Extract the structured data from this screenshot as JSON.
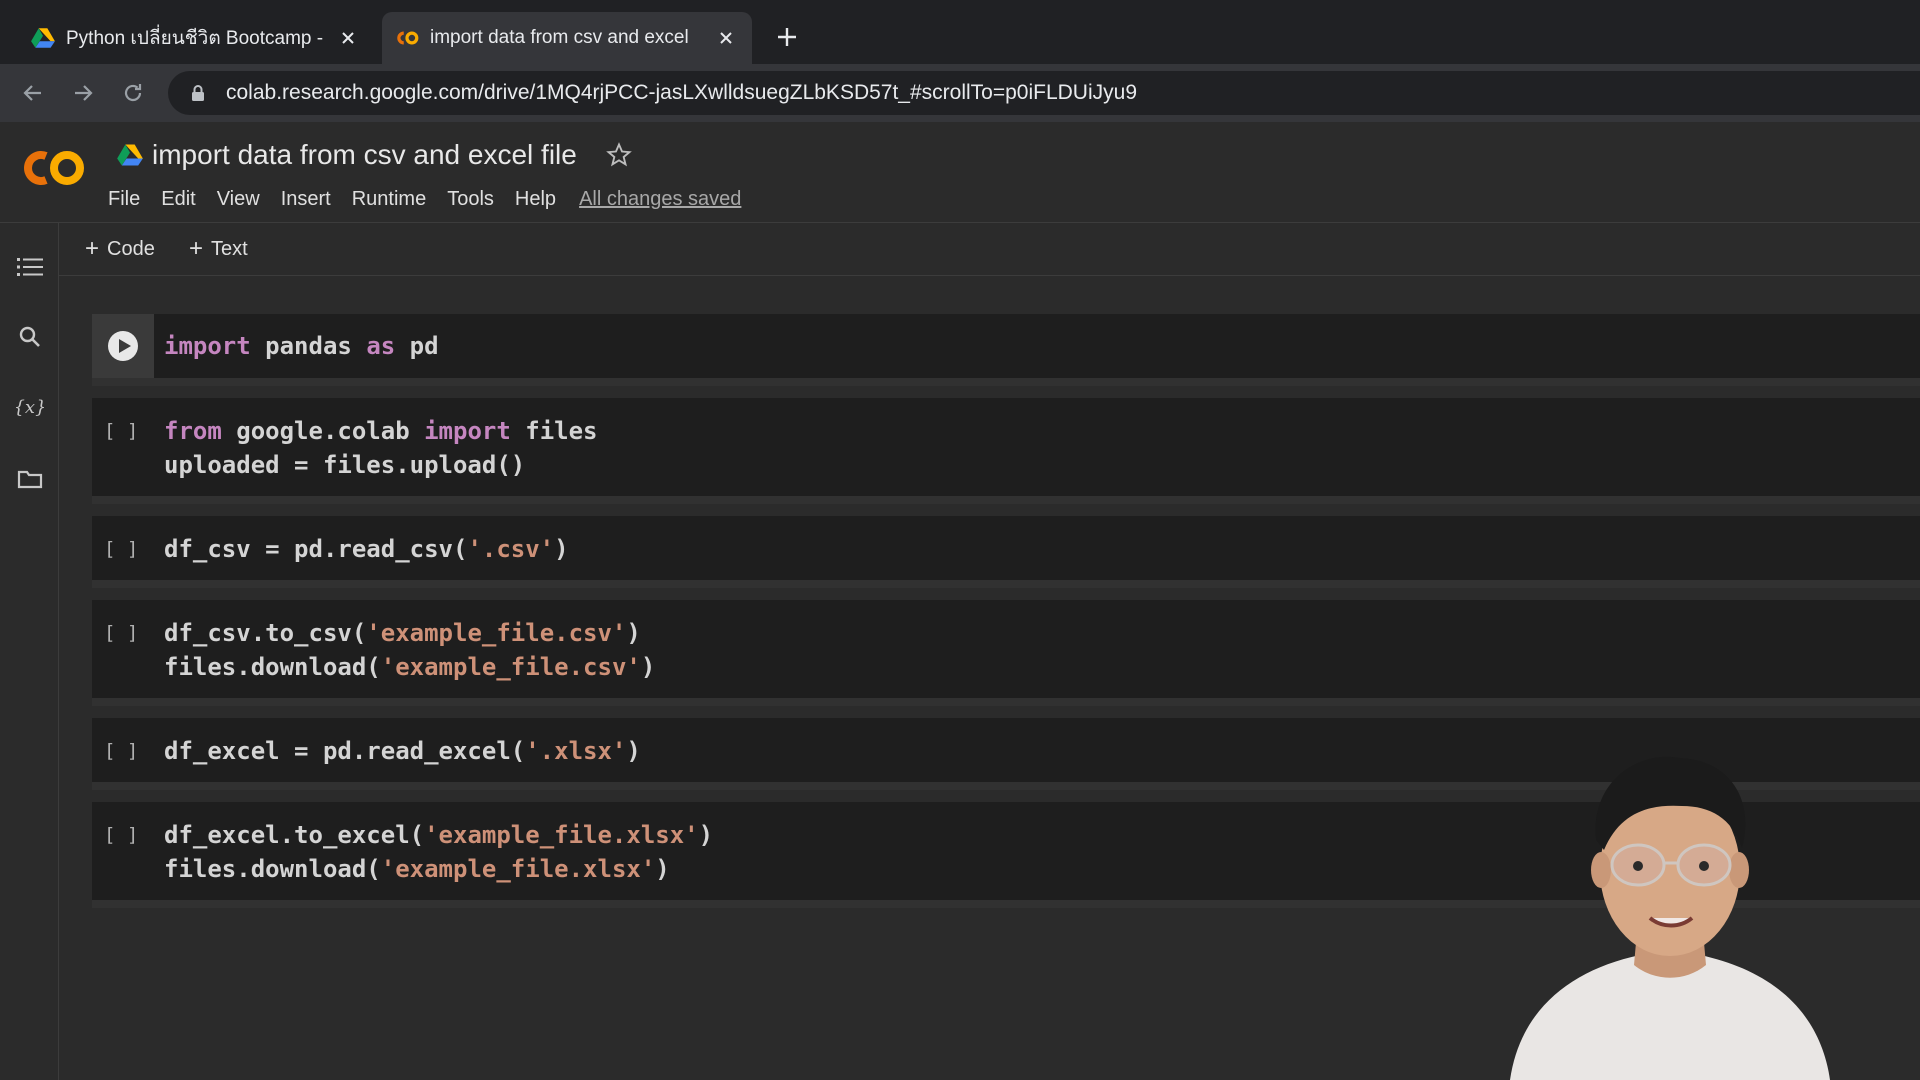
{
  "browser": {
    "tabs": [
      {
        "title": "Python เปลี่ยนชีวิต Bootcamp - (",
        "active": false
      },
      {
        "title": "import data from csv and excel",
        "active": true
      }
    ],
    "url": "colab.research.google.com/drive/1MQ4rjPCC-jasLXwlldsuegZLbKSD57t_#scrollTo=p0iFLDUiJyu9"
  },
  "colab": {
    "logo_text": "CO",
    "notebook_title": "import data from csv and excel file",
    "menu": [
      "File",
      "Edit",
      "View",
      "Insert",
      "Runtime",
      "Tools",
      "Help"
    ],
    "save_status": "All changes saved",
    "add_code_label": "Code",
    "add_text_label": "Text"
  },
  "rail_icons": [
    "table-of-contents-icon",
    "search-icon",
    "variables-icon",
    "files-folder-icon"
  ],
  "cells": [
    {
      "bracket": "",
      "lines": [
        [
          [
            "kw",
            "import"
          ],
          [
            "",
            "pandas "
          ],
          [
            "kw",
            "as"
          ],
          [
            "",
            "pd"
          ]
        ]
      ]
    },
    {
      "bracket": "[ ]",
      "lines": [
        [
          [
            "kw",
            "from"
          ],
          [
            "",
            "google.colab "
          ],
          [
            "kw",
            "import"
          ],
          [
            "",
            "files"
          ]
        ],
        [
          [
            "",
            "uploaded = files.upload()"
          ]
        ]
      ]
    },
    {
      "bracket": "[ ]",
      "lines": [
        [
          [
            "",
            "df_csv = pd.read_csv("
          ],
          [
            "str",
            "'.csv'"
          ],
          [
            "",
            ")"
          ]
        ]
      ]
    },
    {
      "bracket": "[ ]",
      "lines": [
        [
          [
            "",
            "df_csv.to_csv("
          ],
          [
            "str",
            "'example_file.csv'"
          ],
          [
            "",
            ")"
          ]
        ],
        [
          [
            "",
            "files.download("
          ],
          [
            "str",
            "'example_file.csv'"
          ],
          [
            "",
            ")"
          ]
        ]
      ]
    },
    {
      "bracket": "[ ]",
      "lines": [
        [
          [
            "",
            "df_excel = pd.read_excel("
          ],
          [
            "str",
            "'.xlsx'"
          ],
          [
            "",
            ")"
          ]
        ]
      ]
    },
    {
      "bracket": "[ ]",
      "lines": [
        [
          [
            "",
            "df_excel.to_excel("
          ],
          [
            "str",
            "'example_file.xlsx'"
          ],
          [
            "",
            ")"
          ]
        ],
        [
          [
            "",
            "files.download("
          ],
          [
            "str",
            "'example_file.xlsx'"
          ],
          [
            "",
            ")"
          ]
        ]
      ]
    }
  ],
  "colors": {
    "keyword": "#c586c0",
    "string": "#ce9178",
    "logo_orange": "#f9ab00",
    "logo_dark_orange": "#e8710a"
  }
}
